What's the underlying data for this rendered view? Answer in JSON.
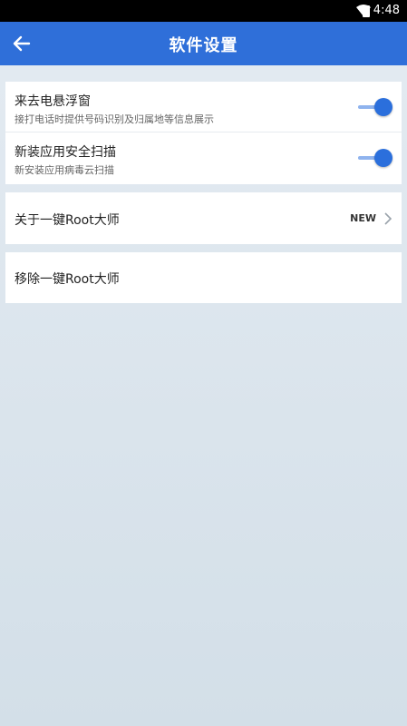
{
  "status_bar": {
    "time": "4:48"
  },
  "app_bar": {
    "title": "软件设置"
  },
  "settings": {
    "floating_window": {
      "title": "来去电悬浮窗",
      "subtitle": "接打电话时提供号码识别及归属地等信息展示",
      "enabled": true
    },
    "install_scan": {
      "title": "新装应用安全扫描",
      "subtitle": "新安装应用病毒云扫描",
      "enabled": true
    },
    "about": {
      "title": "关于一键Root大师",
      "badge": "NEW"
    },
    "remove": {
      "title": "移除一键Root大师"
    }
  },
  "colors": {
    "accent": "#2f6fd9",
    "toggle_on": "#2b6fdc"
  },
  "icons": {
    "back": "arrow-left-icon",
    "chevron": "chevron-right-icon",
    "wifi": "wifi-icon",
    "battery": "battery-icon"
  }
}
